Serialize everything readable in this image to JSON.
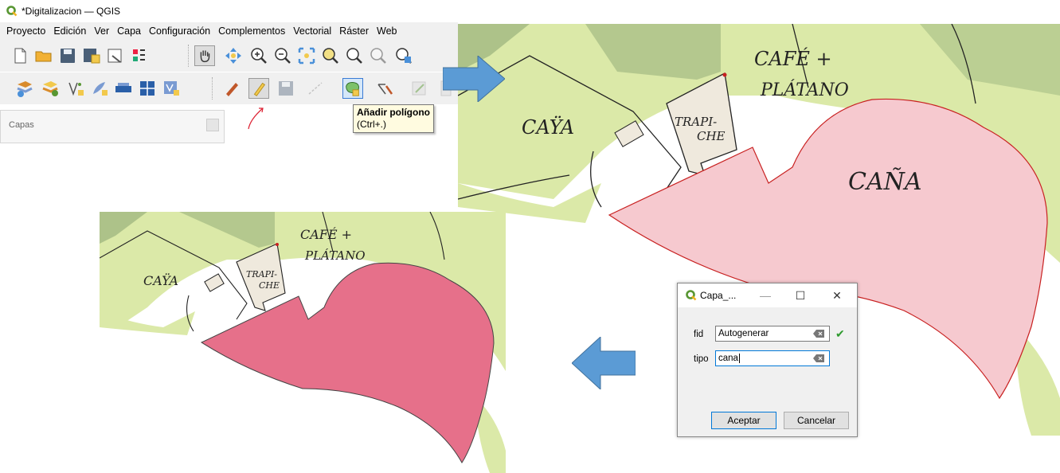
{
  "window": {
    "title": "*Digitalizacion — QGIS"
  },
  "menu": [
    "Proyecto",
    "Edición",
    "Ver",
    "Capa",
    "Configuración",
    "Complementos",
    "Vectorial",
    "Ráster",
    "Web"
  ],
  "layers_panel": {
    "title": "Capas"
  },
  "tooltip": {
    "title": "Añadir polígono",
    "shortcut": "(Ctrl+.)"
  },
  "map_labels": {
    "cafe": "CAFÉ +",
    "platano": "PLÁTANO",
    "caya": "CAŸA",
    "trapiche_1": "TRAPI-",
    "trapiche_2": "CHE",
    "cana": "CAÑA"
  },
  "dialog": {
    "title": "Capa_...",
    "fields": [
      {
        "label": "fid",
        "value": "Autogenerar"
      },
      {
        "label": "tipo",
        "value": "cana"
      }
    ],
    "ok": "Aceptar",
    "cancel": "Cancelar"
  },
  "colors": {
    "accent_arrow": "#5b9bd5",
    "polygon_fill_editing": "#f6c9cf",
    "polygon_fill_saved": "#e6708a",
    "parcel_green": "#dbe9a8",
    "qgis_green": "#589632"
  }
}
